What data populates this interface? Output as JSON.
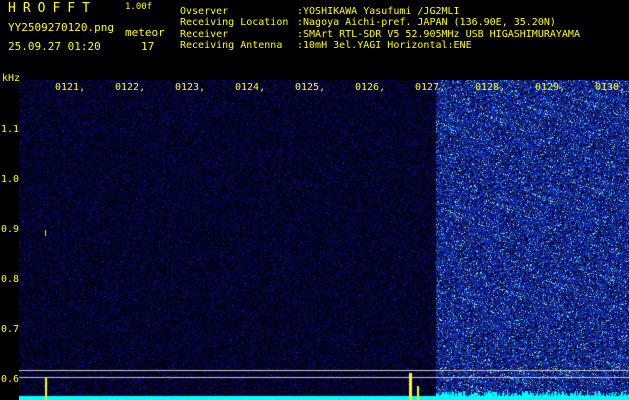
{
  "header": {
    "logo": "HROFFT",
    "version": "1.00f",
    "filename": "YY2509270120.png",
    "datetime": "25.09.27 01:20",
    "meteor_label": "meteor",
    "meteor_count": "17"
  },
  "info": {
    "observer_key": "Ovserver",
    "observer_val": ":YOSHIKAWA Yasufumi /JG2MLI",
    "location_key": "Receiving Location",
    "location_val": ":Nagoya Aichi-pref. JAPAN (136.90E, 35.20N)",
    "receiver_key": "Receiver",
    "receiver_val": ":SMArt RTL-SDR V5 52.905MHz USB HIGASHIMURAYAMA",
    "antenna_key": "Receiving Antenna",
    "antenna_val": ":10mH 3el.YAGI Horizontal:ENE"
  },
  "axis": {
    "y_unit": "kHz",
    "y_ticks": [
      "1.1",
      "1.0",
      "0.9",
      "0.8",
      "0.7",
      "0.6"
    ],
    "x_ticks": [
      "0121",
      "0122",
      "0123",
      "0124",
      "0125",
      "0126",
      "0127",
      "0128",
      "0129",
      "0130"
    ]
  },
  "colors": {
    "text": "#ffff00",
    "background": "#000000",
    "noise_dark": "#0a0a3c",
    "noise_bright": "#1e3cff",
    "baseline": "#00ffff"
  }
}
